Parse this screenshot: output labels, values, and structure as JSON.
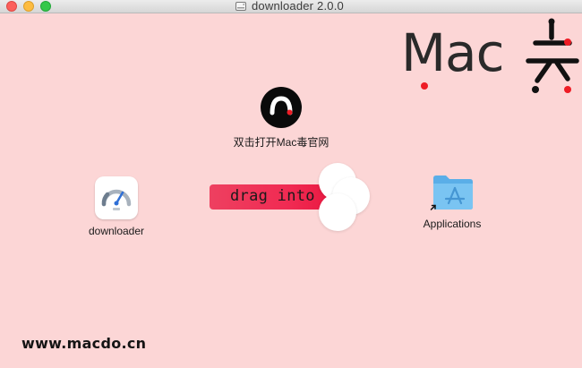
{
  "window": {
    "title": "downloader 2.0.0",
    "title_icon": "disk-image-icon",
    "background": "#fcd6d6",
    "controls": {
      "close_color": "#fc605c",
      "minimize_color": "#fdbc40",
      "maximize_color": "#34c84a"
    }
  },
  "branding": {
    "logo_text": "Mac",
    "accent_color": "#ee1c25",
    "site_icon": "macdo-site-icon",
    "site_label": "双击打开Mac毒官网",
    "footer_url": "www.macdo.cn"
  },
  "installer": {
    "app_label": "downloader",
    "app_icon": "speedometer-icon",
    "drag_text": "drag into",
    "drag_color": "#f02a52",
    "target_label": "Applications",
    "target_icon": "applications-folder-icon"
  }
}
